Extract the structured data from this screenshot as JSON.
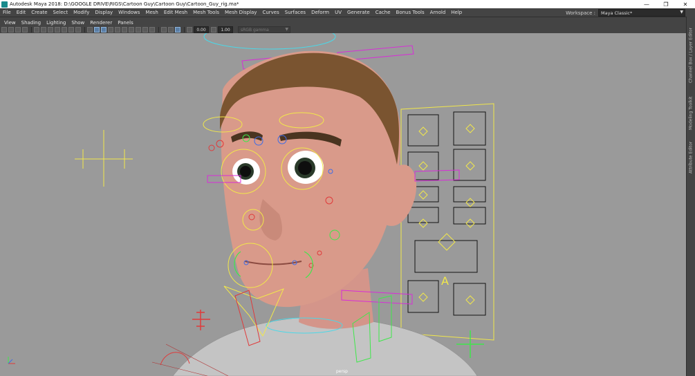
{
  "window": {
    "title": "Autodesk Maya 2018: D:\\GOOGLE DRIVE\\RIGS\\Cartoon Guy\\Cartoon Guy\\Cartoon_Guy_rig.ma*",
    "minimize": "—",
    "restore": "❐",
    "close": "✕"
  },
  "menubar": {
    "items": [
      "File",
      "Edit",
      "Create",
      "Select",
      "Modify",
      "Display",
      "Windows",
      "Mesh",
      "Edit Mesh",
      "Mesh Tools",
      "Mesh Display",
      "Curves",
      "Surfaces",
      "Deform",
      "UV",
      "Generate",
      "Cache",
      "Bonus Tools",
      "Arnold",
      "Help"
    ]
  },
  "workspace": {
    "label": "Workspace :",
    "value": "Maya Classic*"
  },
  "panel_menu": {
    "items": [
      "View",
      "Shading",
      "Lighting",
      "Show",
      "Renderer",
      "Panels"
    ]
  },
  "toolbar": {
    "field_1": "0.00",
    "field_2": "1.00",
    "color_space": "sRGB gamma"
  },
  "viewport": {
    "camera_label": "persp",
    "control_letter": "A"
  },
  "side_tabs": [
    "Channel Box / Layer Editor",
    "Modeling Toolkit",
    "Attribute Editor"
  ],
  "colors": {
    "viewport_bg": "#9a9a9a",
    "ui_bg": "#444444",
    "control_yellow": "#f2e84a",
    "control_red": "#e03a3a",
    "control_magenta": "#d82cd8",
    "control_green": "#3ee84a",
    "control_cyan": "#4ad8e8",
    "skin": "#d99a8a",
    "hair": "#7a5430"
  }
}
